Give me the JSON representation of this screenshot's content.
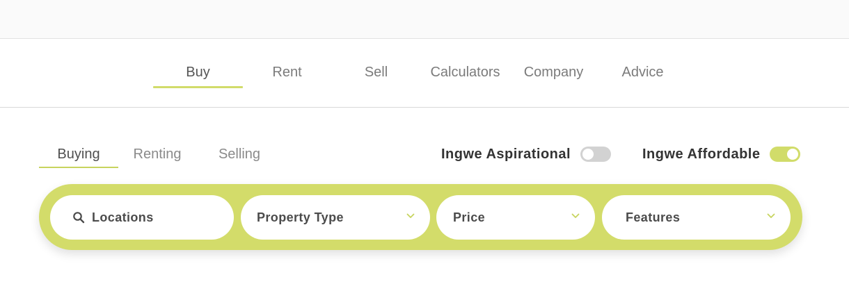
{
  "main_nav": {
    "tabs": [
      {
        "label": "Buy",
        "active": true
      },
      {
        "label": "Rent",
        "active": false
      },
      {
        "label": "Sell",
        "active": false
      },
      {
        "label": "Calculators",
        "active": false
      },
      {
        "label": "Company",
        "active": false
      },
      {
        "label": "Advice",
        "active": false
      }
    ]
  },
  "sub_nav": {
    "tabs": [
      {
        "label": "Buying",
        "active": true
      },
      {
        "label": "Renting",
        "active": false
      },
      {
        "label": "Selling",
        "active": false
      }
    ]
  },
  "toggles": {
    "aspirational": {
      "label": "Ingwe Aspirational",
      "on": false
    },
    "affordable": {
      "label": "Ingwe Affordable",
      "on": true
    }
  },
  "search": {
    "locations": "Locations",
    "property_type": "Property Type",
    "price": "Price",
    "features": "Features"
  },
  "colors": {
    "accent": "#d1dc6a",
    "switch_off": "#d2d2d2"
  }
}
